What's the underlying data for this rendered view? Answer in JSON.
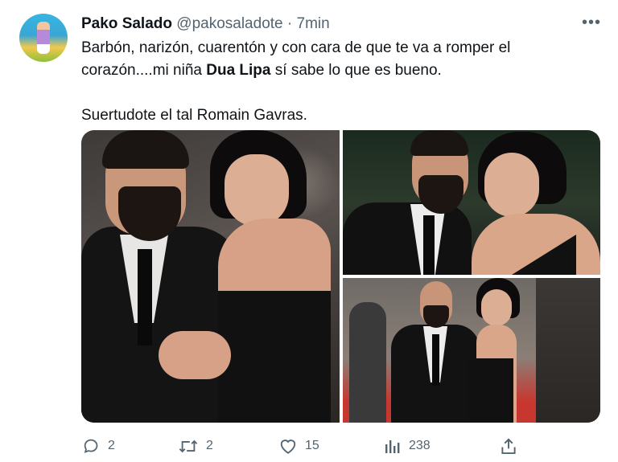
{
  "tweet": {
    "author_name": "Pako Salado",
    "handle": "@pakosaladote",
    "separator": "·",
    "time": "7min",
    "more_label": "•••",
    "text_line1": "Barbón, narizón, cuarentón y con cara de que te va a romper el corazón....mi niña ",
    "text_bold": "Dua Lipa",
    "text_line1_end": " sí sabe lo que es bueno.",
    "text_line2": "Suertudote el tal Romain Gavras."
  },
  "media": {
    "photos": [
      {
        "label": "photo-1"
      },
      {
        "label": "photo-2"
      },
      {
        "label": "photo-3"
      }
    ]
  },
  "actions": {
    "reply": {
      "icon": "reply-icon",
      "count": "2"
    },
    "retweet": {
      "icon": "retweet-icon",
      "count": "2"
    },
    "like": {
      "icon": "heart-icon",
      "count": "15"
    },
    "views": {
      "icon": "analytics-icon",
      "count": "238"
    },
    "share": {
      "icon": "share-icon"
    }
  },
  "colors": {
    "text": "#0f1419",
    "muted": "#536471",
    "background": "#ffffff"
  }
}
